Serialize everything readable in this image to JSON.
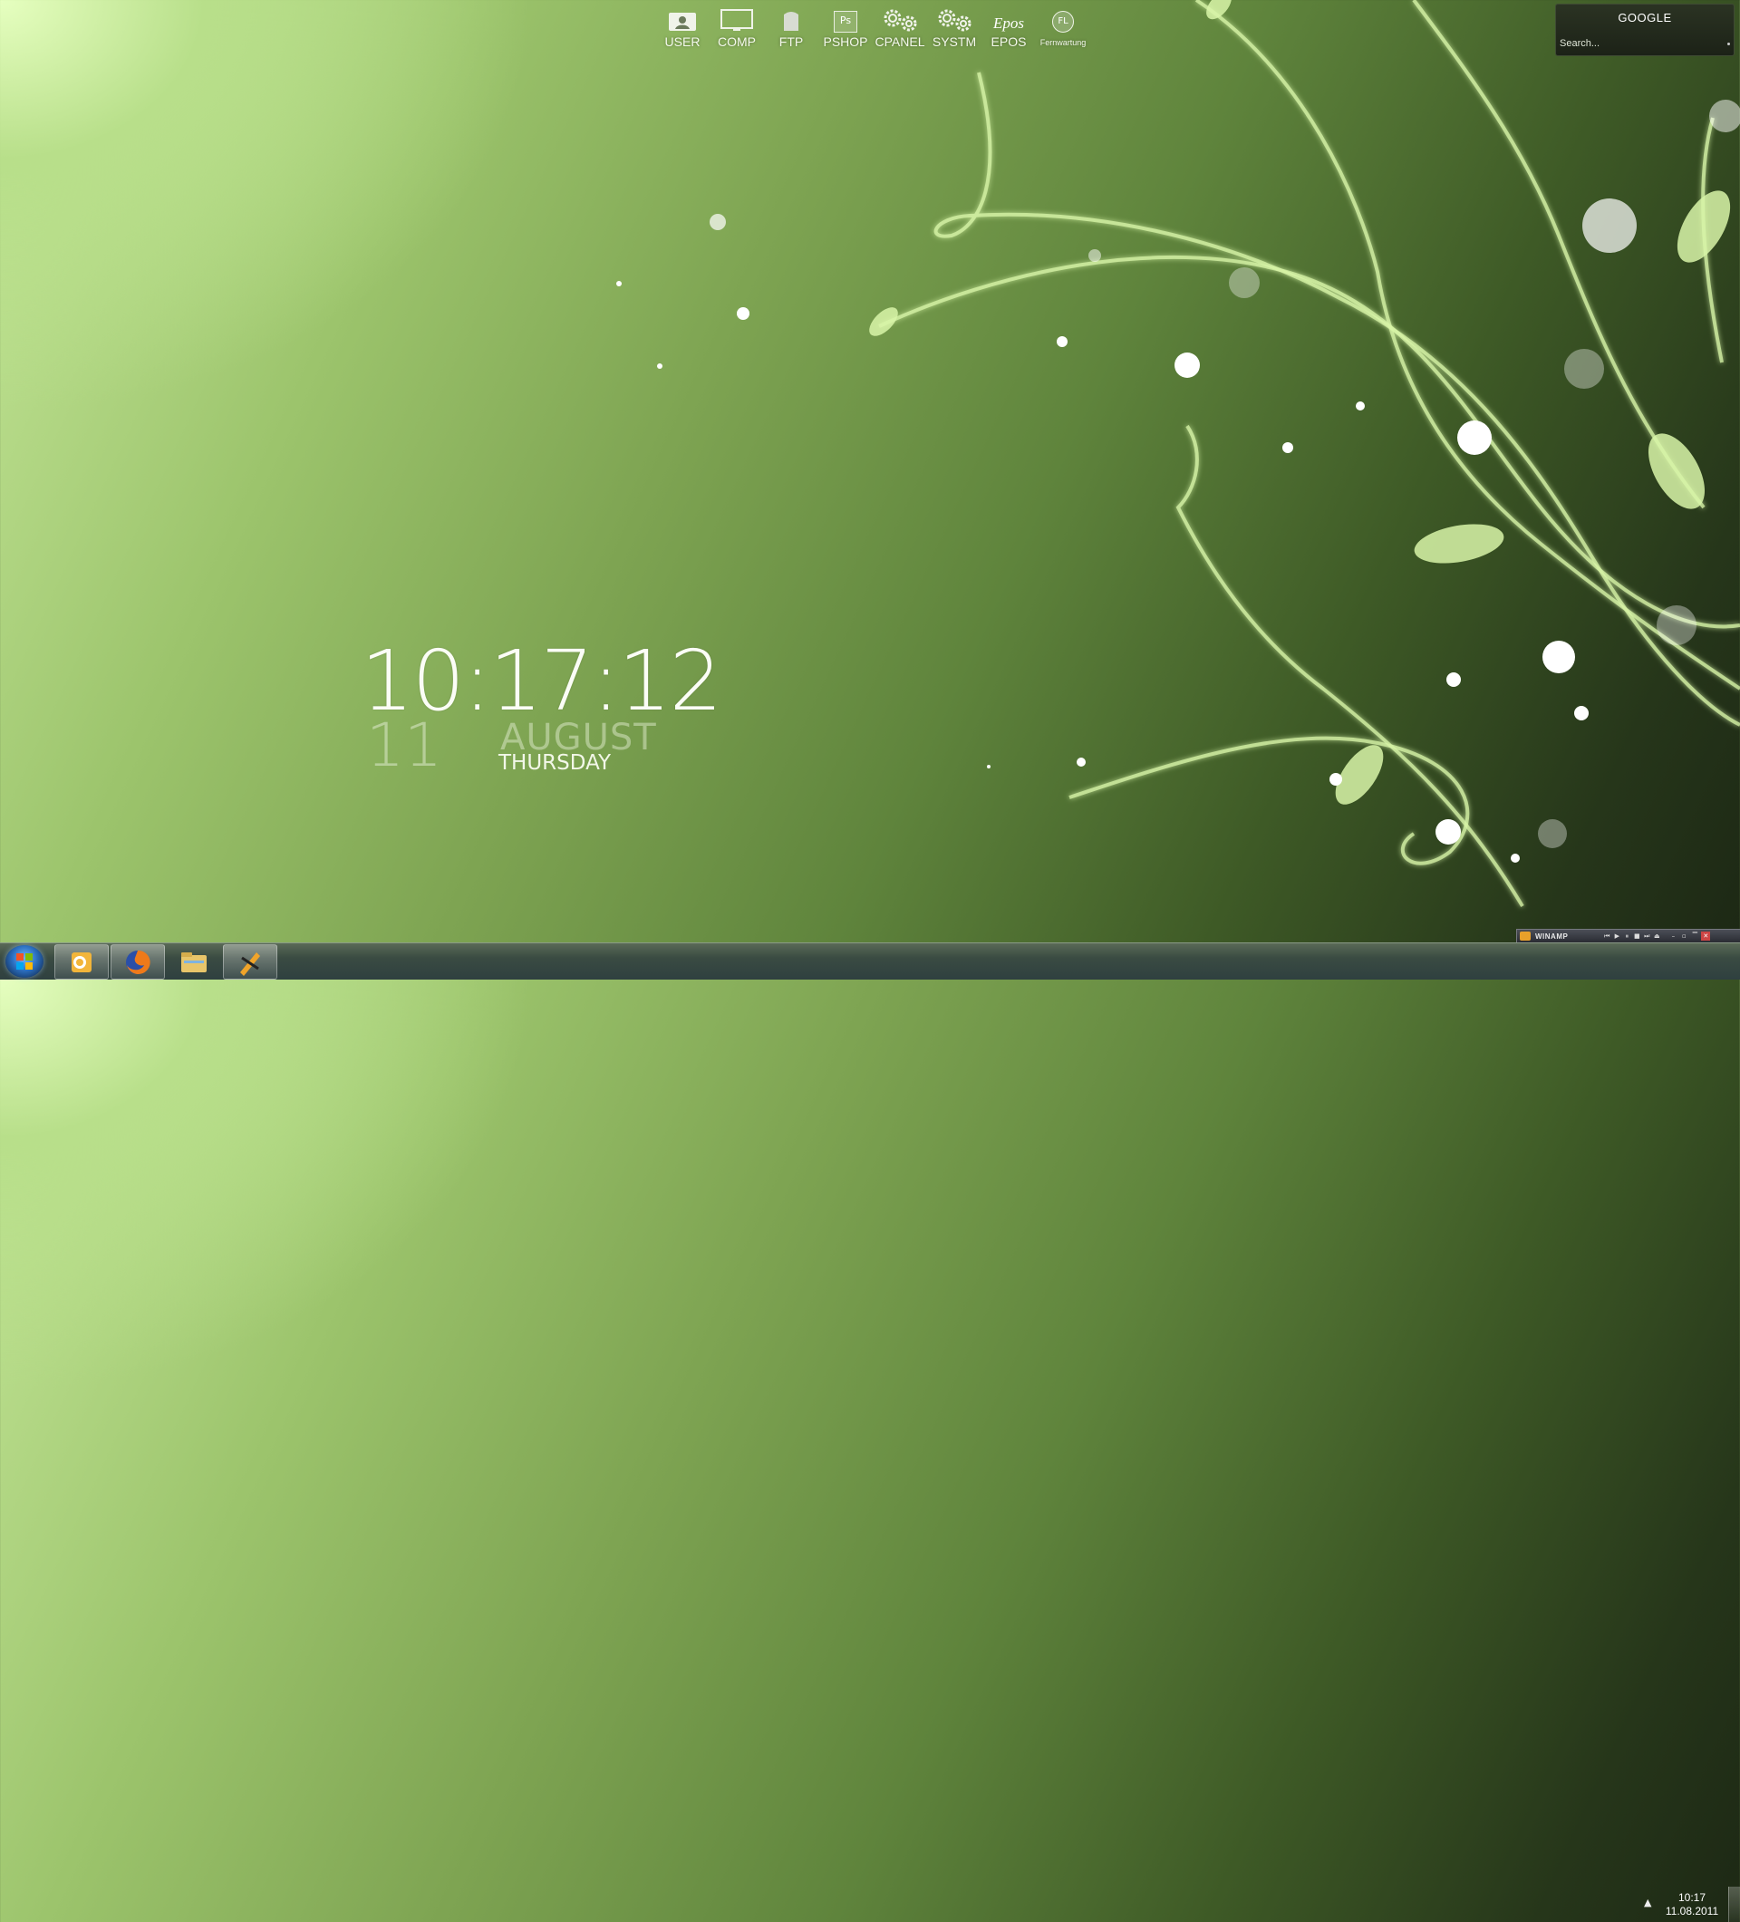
{
  "launcher": {
    "items": [
      {
        "label": "USER",
        "icon": "user-icon"
      },
      {
        "label": "COMP",
        "icon": "monitor-icon"
      },
      {
        "label": "FTP",
        "icon": "ftp-icon"
      },
      {
        "label": "PSHOP",
        "icon": "photoshop-icon"
      },
      {
        "label": "CPANEL",
        "icon": "gears-icon"
      },
      {
        "label": "SYSTM",
        "icon": "gears-icon"
      },
      {
        "label": "EPOS",
        "icon": "epos-icon"
      },
      {
        "label": "Fernwartung",
        "icon": "remote-icon"
      }
    ],
    "photoshop_glyph": "Ps",
    "epos_glyph": "Epos",
    "remote_glyph": "FL"
  },
  "google": {
    "title": "GOOGLE",
    "placeholder": "Search..."
  },
  "clock": {
    "time": "10:17:12",
    "day": "11",
    "month": "AUGUST",
    "weekday": "THURSDAY"
  },
  "taskbar": {
    "pinned": [
      "outlook-icon",
      "firefox-icon",
      "explorer-icon",
      "winamp-icon"
    ],
    "tray_time": "10:17",
    "tray_date": "11.08.2011",
    "tray_arrow": "▲"
  },
  "winamp": {
    "title": "WINAMP",
    "controls": [
      "⏮",
      "▶",
      "⏸",
      "■",
      "⏭",
      "⏏"
    ],
    "window": [
      "–",
      "▫",
      "▔",
      "✕"
    ],
    "accent": "#e8a02a"
  },
  "colors": {
    "wallpaper_light": "#e6ffc0",
    "wallpaper_dark": "#1c2714",
    "vine": "#d8f5a8"
  }
}
